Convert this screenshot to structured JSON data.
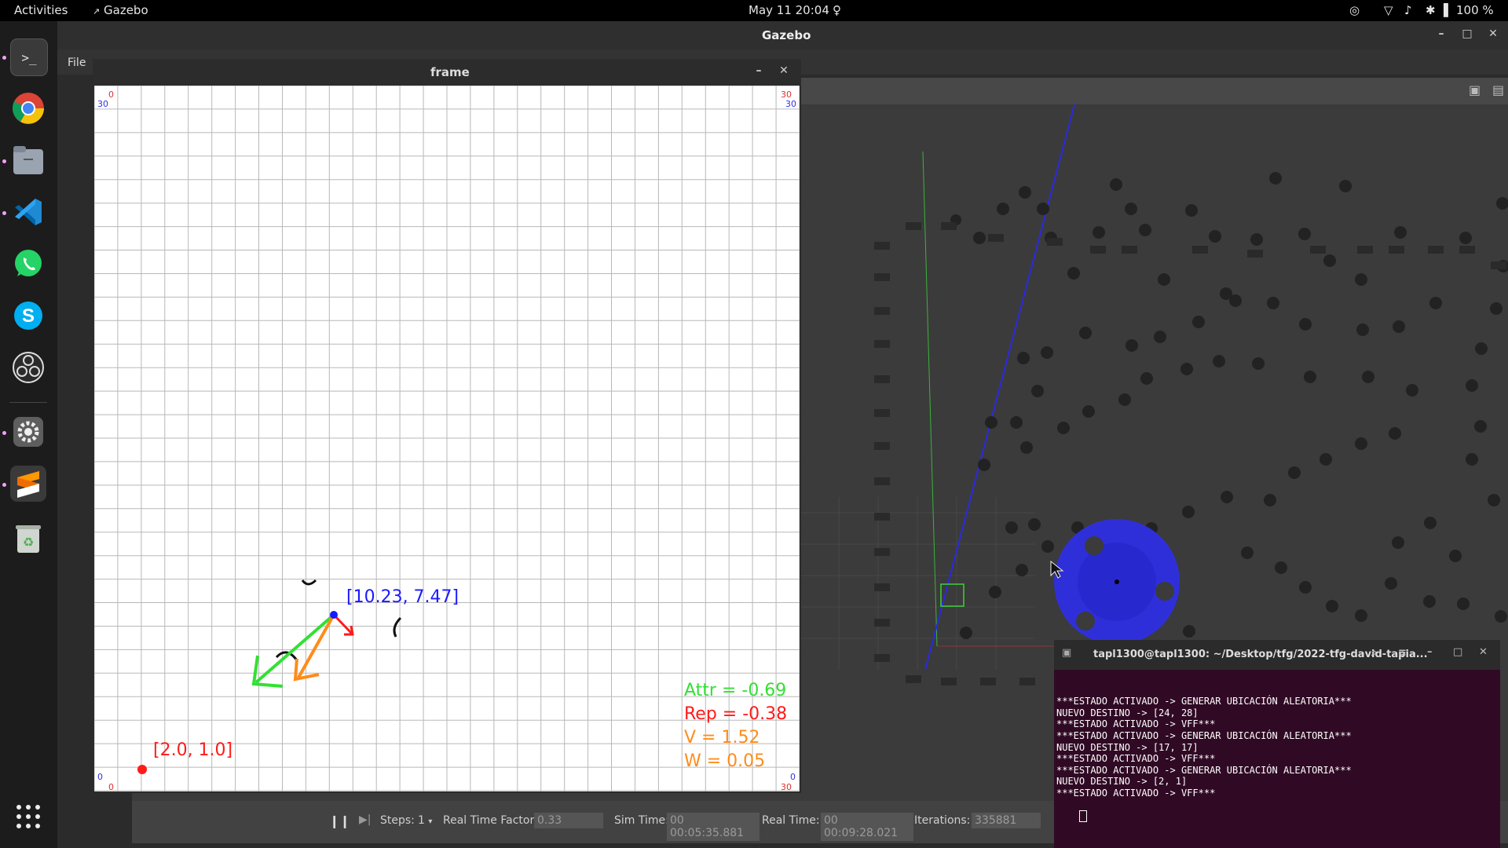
{
  "topbar": {
    "activities": "Activities",
    "app_name": "Gazebo",
    "datetime": "May 11  20:04",
    "battery": "100 %"
  },
  "dock": {
    "apps": [
      "terminal-icon",
      "chrome-icon",
      "files-icon",
      "vscode-icon",
      "whatsapp-icon",
      "skype-icon",
      "obs-icon",
      "settings-icon",
      "sublime-icon",
      "trash-icon",
      "app-grid-icon"
    ]
  },
  "gazebo": {
    "title": "Gazebo",
    "menu_file": "File",
    "bottom": {
      "steps_label": "Steps:",
      "steps_value": "1",
      "rtf_label": "Real Time Factor:",
      "rtf_value": "0.33",
      "sim_time_label": "Sim Time:",
      "sim_time_value": "00 00:05:35.881",
      "real_time_label": "Real Time:",
      "real_time_value": "00 00:09:28.021",
      "iterations_label": "Iterations:",
      "iterations_value": "335881"
    }
  },
  "frame": {
    "title": "frame",
    "corner_labels": {
      "tl_top": "0",
      "tl_bottom": "30",
      "tr_top": "30",
      "tr_bottom": "30",
      "bl_top": "0",
      "bl_bottom": "0",
      "br_top": "0",
      "br_bottom": "30"
    },
    "robot_position": "[10.23, 7.47]",
    "goal_position": "[2.0, 1.0]",
    "attr_text": "Attr = -0.69",
    "rep_text": "Rep  = -0.38",
    "v_text": "V = 1.52",
    "w_text": "W = 0.05",
    "colors": {
      "robot": "#1a1aff",
      "goal": "#ff1a1a",
      "attr": "#33e033",
      "repulsive": "#ff1a1a",
      "result": "#ff8c1a",
      "v": "#ff8c1a",
      "w": "#ff8c1a"
    }
  },
  "terminal": {
    "title": "tapl1300@tapl1300: ~/Desktop/tfg/2022-tfg-david-tapia...",
    "lines": [
      "***ESTADO ACTIVADO -> GENERAR UBICACIÓN ALEATORIA***",
      "NUEVO DESTINO -> [24, 28]",
      "***ESTADO ACTIVADO -> VFF***",
      "***ESTADO ACTIVADO -> GENERAR UBICACIÓN ALEATORIA***",
      "NUEVO DESTINO -> [17, 17]",
      "***ESTADO ACTIVADO -> VFF***",
      "***ESTADO ACTIVADO -> GENERAR UBICACIÓN ALEATORIA***",
      "NUEVO DESTINO -> [2, 1]",
      "***ESTADO ACTIVADO -> VFF***"
    ]
  }
}
